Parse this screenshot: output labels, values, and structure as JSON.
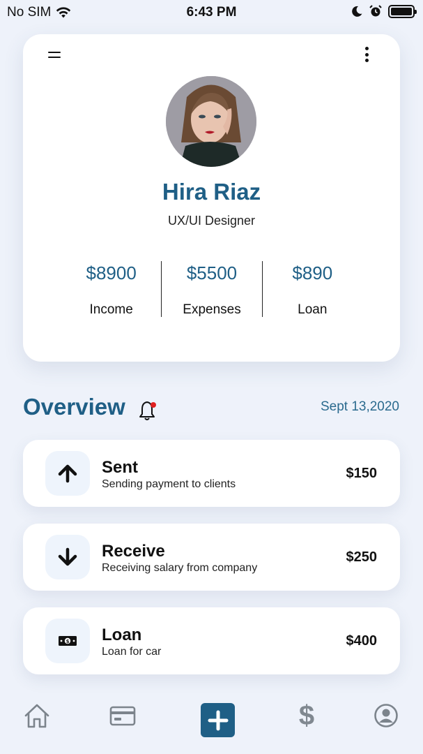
{
  "status_bar": {
    "carrier": "No SIM",
    "time": "6:43 PM"
  },
  "profile": {
    "name": "Hira Riaz",
    "role": "UX/UI Designer",
    "stats": [
      {
        "value": "$8900",
        "label": "Income"
      },
      {
        "value": "$5500",
        "label": "Expenses"
      },
      {
        "value": "$890",
        "label": "Loan"
      }
    ]
  },
  "overview": {
    "title": "Overview",
    "date": "Sept 13,2020",
    "has_notification": true
  },
  "transactions": [
    {
      "title": "Sent",
      "subtitle": "Sending payment to clients",
      "amount": "$150",
      "icon": "arrow-up-icon"
    },
    {
      "title": "Receive",
      "subtitle": "Receiving salary from company",
      "amount": "$250",
      "icon": "arrow-down-icon"
    },
    {
      "title": "Loan",
      "subtitle": "Loan for car",
      "amount": "$400",
      "icon": "money-icon"
    }
  ],
  "bottom_nav": {
    "items": [
      "home-icon",
      "card-icon",
      "plus-icon",
      "dollar-icon",
      "profile-icon"
    ],
    "dollar_glyph": "$",
    "active": "plus-icon"
  },
  "colors": {
    "accent": "#1f5f86",
    "background": "#eef2fa",
    "card": "#ffffff",
    "notification_dot": "#e02020"
  }
}
